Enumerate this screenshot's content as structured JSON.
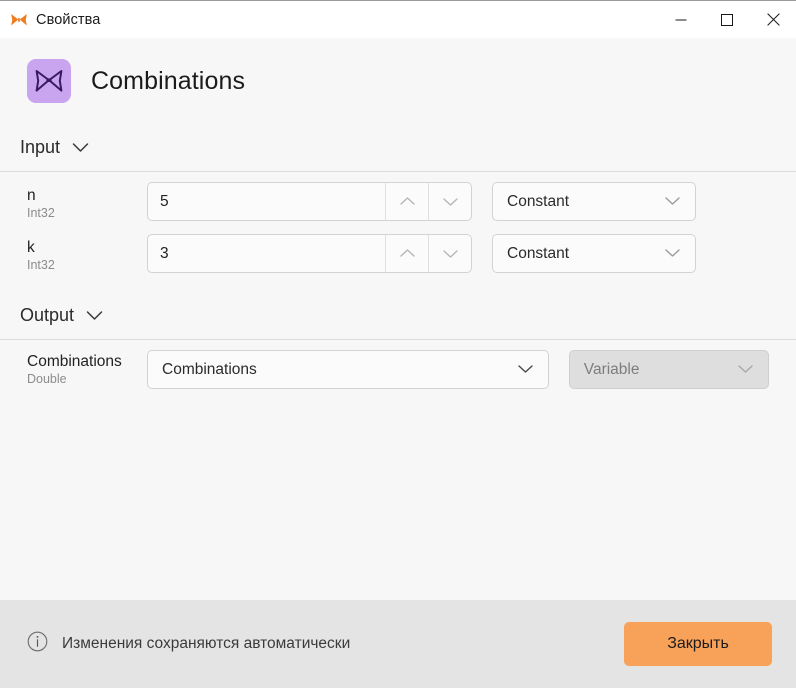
{
  "window": {
    "titlebar_title": "Свойства",
    "app_icon": "butterfly-icon",
    "minimize_label": "Свернуть",
    "maximize_label": "Развернуть",
    "close_label": "Закрыть окно"
  },
  "header": {
    "title": "Combinations",
    "icon": "butterfly-icon",
    "icon_tile_color": "#c9a5ef"
  },
  "sections": {
    "input": {
      "label": "Input",
      "chevron": "chevron-down-icon",
      "rows": [
        {
          "name": "n",
          "type": "Int32",
          "value": "5",
          "placeholder": "",
          "mode": "Constant",
          "mode_chevron": "chevron-down-icon",
          "spinner_up": "chevron-up-icon",
          "spinner_down": "chevron-down-icon"
        },
        {
          "name": "k",
          "type": "Int32",
          "value": "3",
          "placeholder": "",
          "mode": "Constant",
          "mode_chevron": "chevron-down-icon",
          "spinner_up": "chevron-up-icon",
          "spinner_down": "chevron-down-icon"
        }
      ]
    },
    "output": {
      "label": "Output",
      "chevron": "chevron-down-icon",
      "rows": [
        {
          "name": "Combinations",
          "type": "Double",
          "value": "Combinations",
          "value_chevron": "chevron-down-icon",
          "mode": "Variable",
          "mode_chevron": "chevron-down-icon",
          "mode_disabled": true
        }
      ]
    }
  },
  "footer": {
    "info_icon": "info-circle-icon",
    "note": "Изменения сохраняются автоматически",
    "close_button": "Закрыть",
    "close_button_color": "#f8a158"
  }
}
